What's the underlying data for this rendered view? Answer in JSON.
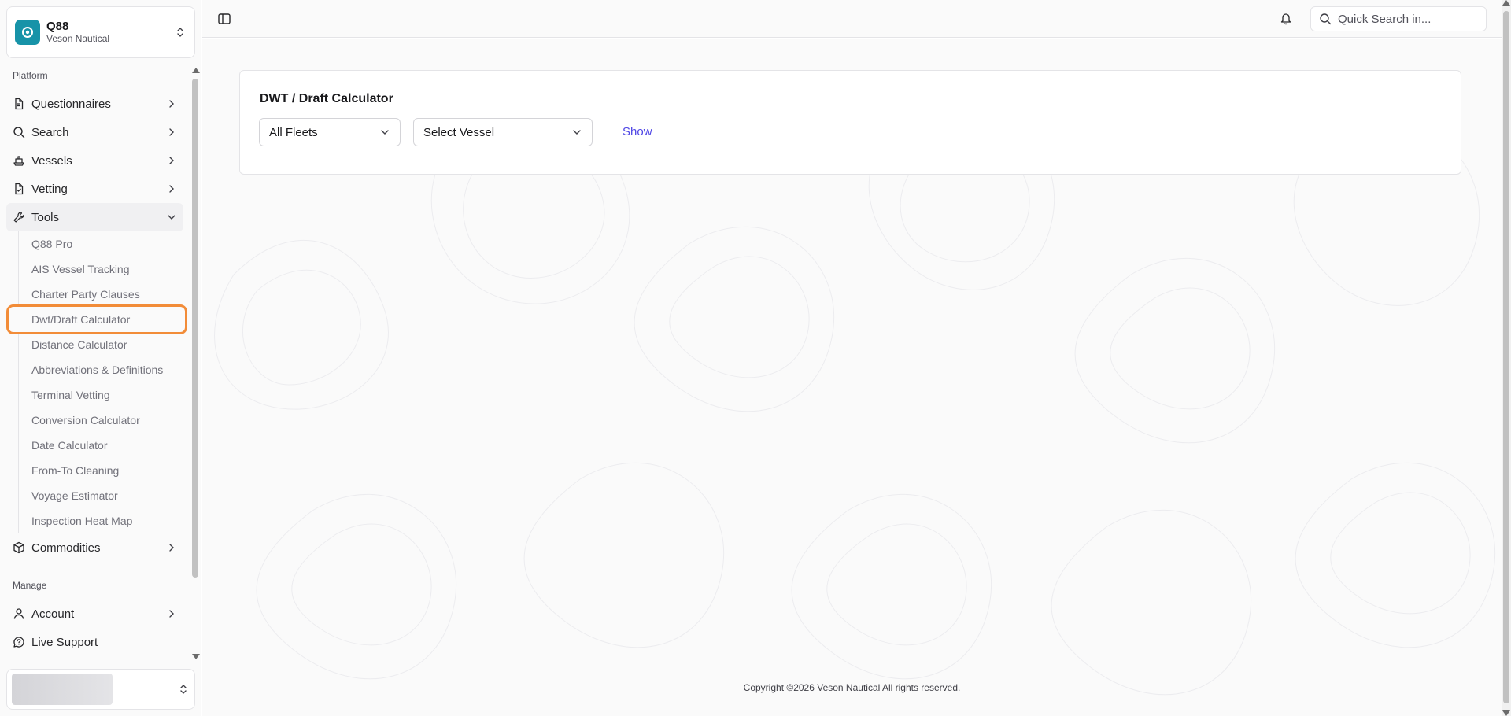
{
  "org": {
    "name": "Q88",
    "subtitle": "Veson Nautical"
  },
  "sidebar": {
    "platform_label": "Platform",
    "platform_items": [
      {
        "label": "Questionnaires",
        "icon": "file-text-icon"
      },
      {
        "label": "Search",
        "icon": "search-icon"
      },
      {
        "label": "Vessels",
        "icon": "ship-icon"
      },
      {
        "label": "Vetting",
        "icon": "file-check-icon"
      },
      {
        "label": "Tools",
        "icon": "wrench-icon"
      }
    ],
    "tools_sub": [
      "Q88 Pro",
      "AIS Vessel Tracking",
      "Charter Party Clauses",
      "Dwt/Draft Calculator",
      "Distance Calculator",
      "Abbreviations & Definitions",
      "Terminal Vetting",
      "Conversion Calculator",
      "Date Calculator",
      "From-To Cleaning",
      "Voyage Estimator",
      "Inspection Heat Map"
    ],
    "commodities": {
      "label": "Commodities",
      "icon": "box-icon"
    },
    "manage_label": "Manage",
    "manage_items": [
      {
        "label": "Account",
        "icon": "user-icon"
      },
      {
        "label": "Live Support",
        "icon": "message-circle-icon"
      }
    ]
  },
  "header": {
    "search_placeholder": "Quick Search in..."
  },
  "calculator": {
    "title": "DWT / Draft Calculator",
    "fleet_select": "All Fleets",
    "vessel_select": "Select Vessel",
    "show_label": "Show"
  },
  "footer": {
    "copyright": "Copyright ©2026 Veson Nautical All rights reserved."
  },
  "colors": {
    "accent": "#4f46e5",
    "logo": "#1793a8",
    "highlight": "#f28c38"
  }
}
